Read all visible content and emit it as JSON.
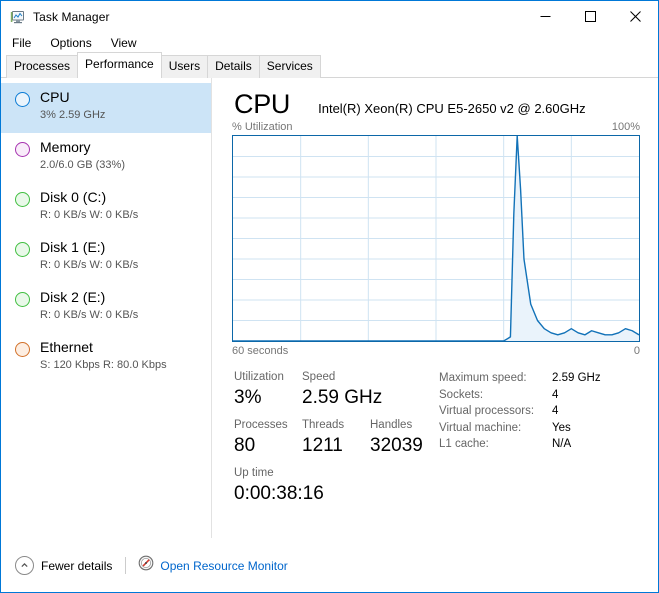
{
  "window": {
    "title": "Task Manager",
    "icon": "task-manager-icon",
    "minimize_label": "—",
    "maximize_label": "☐",
    "close_label": "✕"
  },
  "menu": {
    "items": [
      {
        "label": "File"
      },
      {
        "label": "Options"
      },
      {
        "label": "View"
      }
    ]
  },
  "tabs": {
    "items": [
      {
        "label": "Processes",
        "active": false
      },
      {
        "label": "Performance",
        "active": true
      },
      {
        "label": "Users",
        "active": false
      },
      {
        "label": "Details",
        "active": false
      },
      {
        "label": "Services",
        "active": false
      }
    ]
  },
  "sidebar": {
    "items": [
      {
        "name": "CPU",
        "title": "CPU",
        "subtitle": "3% 2.59 GHz",
        "color": "#0c7cd5",
        "fill": "#eaf4fc",
        "selected": true
      },
      {
        "name": "Memory",
        "title": "Memory",
        "subtitle": "2.0/6.0 GB (33%)",
        "color": "#a734b0",
        "fill": "#f9ecfa",
        "selected": false
      },
      {
        "name": "Disk 0 (C:)",
        "title": "Disk 0 (C:)",
        "subtitle": "R: 0 KB/s  W: 0 KB/s",
        "color": "#41bf41",
        "fill": "#e9f9e9",
        "selected": false
      },
      {
        "name": "Disk 1 (E:)",
        "title": "Disk 1 (E:)",
        "subtitle": "R: 0 KB/s  W: 0 KB/s",
        "color": "#41bf41",
        "fill": "#e9f9e9",
        "selected": false
      },
      {
        "name": "Disk 2 (E:)",
        "title": "Disk 2 (E:)",
        "subtitle": "R: 0 KB/s  W: 0 KB/s",
        "color": "#41bf41",
        "fill": "#e9f9e9",
        "selected": false
      },
      {
        "name": "Ethernet",
        "title": "Ethernet",
        "subtitle": "S: 120 Kbps  R: 80.0 Kbps",
        "color": "#d2712a",
        "fill": "#fdeee2",
        "selected": false
      }
    ]
  },
  "pane": {
    "title": "CPU",
    "subtitle": "Intel(R) Xeon(R) CPU E5-2650 v2 @ 2.60GHz"
  },
  "chart_data": {
    "type": "area",
    "title": "% Utilization",
    "y_axis_max_label": "100%",
    "x_left_label": "60 seconds",
    "x_right_label": "0",
    "ylim": [
      0,
      100
    ],
    "xlim": [
      0,
      60
    ],
    "grid": true,
    "grid_columns": 6,
    "grid_rows": 10,
    "line_color": "#1272b8",
    "fill_color": "#eaf3fb",
    "border_color": "#0c67a8",
    "xlabel": "seconds",
    "ylabel": "% Utilization",
    "x": [
      0,
      2,
      4,
      6,
      8,
      10,
      12,
      14,
      16,
      18,
      20,
      22,
      24,
      26,
      28,
      30,
      32,
      34,
      36,
      38,
      40,
      41,
      41.5,
      42,
      42.5,
      43,
      44,
      45,
      46,
      47,
      48,
      49,
      50,
      51,
      52,
      53,
      54,
      55,
      56,
      57,
      58,
      59,
      60
    ],
    "values": [
      0,
      0,
      0,
      0,
      0,
      0,
      0,
      0,
      0,
      0,
      0,
      0,
      0,
      0,
      0,
      0,
      0,
      0,
      0,
      0,
      0,
      2,
      62,
      100,
      74,
      40,
      18,
      10,
      6,
      4,
      3,
      4,
      6,
      4,
      3,
      5,
      4,
      3,
      3,
      4,
      6,
      5,
      3
    ]
  },
  "stats": {
    "left": [
      {
        "label": "Utilization",
        "value": "3%"
      },
      {
        "label": "Speed",
        "value": "2.59 GHz"
      },
      {
        "label": "Processes",
        "value": "80"
      },
      {
        "label": "Threads",
        "value": "1211"
      },
      {
        "label": "Handles",
        "value": "32039"
      },
      {
        "label": "Up time",
        "value": "0:00:38:16"
      }
    ],
    "right": [
      {
        "key": "Maximum speed:",
        "value": "2.59 GHz"
      },
      {
        "key": "Sockets:",
        "value": "4"
      },
      {
        "key": "Virtual processors:",
        "value": "4"
      },
      {
        "key": "Virtual machine:",
        "value": "Yes"
      },
      {
        "key": "L1 cache:",
        "value": "N/A"
      }
    ]
  },
  "footer": {
    "fewer_details_label": "Fewer details",
    "resource_monitor_label": "Open Resource Monitor",
    "link_color": "#0066cc"
  }
}
